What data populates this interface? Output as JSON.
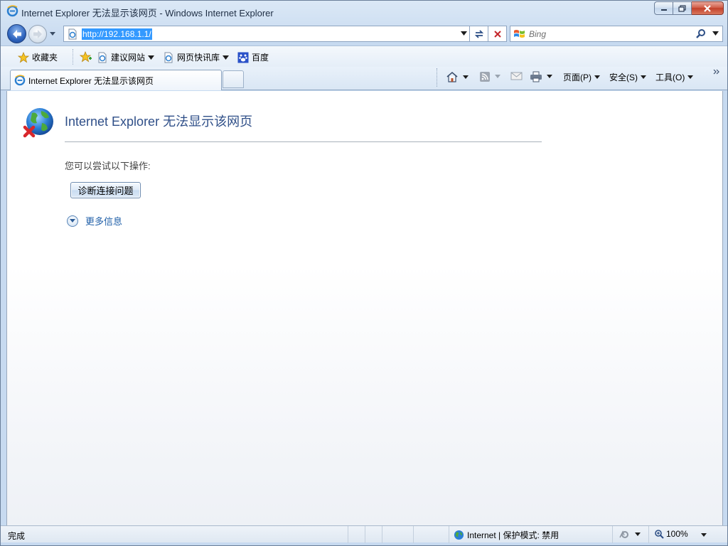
{
  "window": {
    "title": "Internet Explorer 无法显示该网页 - Windows Internet Explorer"
  },
  "address_bar": {
    "url": "http://192.168.1.1/"
  },
  "search": {
    "placeholder": "Bing"
  },
  "favorites_bar": {
    "favorites_label": "收藏夹",
    "items": [
      {
        "label": "建议网站",
        "icon": "ie-page-icon"
      },
      {
        "label": "网页快讯库",
        "icon": "ie-page-icon"
      },
      {
        "label": "百度",
        "icon": "baidu-paw-icon"
      }
    ]
  },
  "tabs": [
    {
      "label": "Internet Explorer 无法显示该网页"
    }
  ],
  "command_bar": {
    "page_menu": "页面(P)",
    "safety_menu": "安全(S)",
    "tools_menu": "工具(O)"
  },
  "content": {
    "heading": "Internet Explorer 无法显示该网页",
    "instruction": "您可以尝试以下操作:",
    "diagnose_button": "诊断连接问题",
    "more_info": "更多信息"
  },
  "status_bar": {
    "status": "完成",
    "zone": "Internet | 保护模式: 禁用",
    "zoom": "100%"
  },
  "colors": {
    "accent": "#2f4f88",
    "link": "#1f5fa8",
    "selection": "#3399ff"
  }
}
